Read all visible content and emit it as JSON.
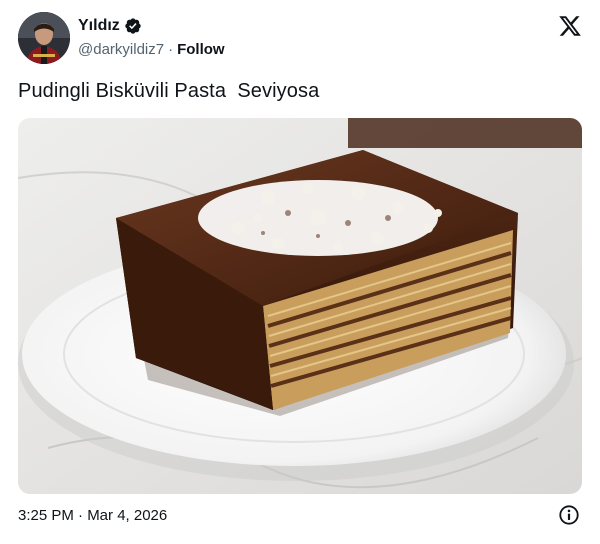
{
  "author": {
    "display_name": "Yıldız",
    "handle": "@darkyildiz7",
    "separator": "·",
    "follow_label": "Follow",
    "verified": true
  },
  "brand_icon": "x-logo-icon",
  "tweet": {
    "text": "Pudingli Bisküvili Pasta  Seviyosa"
  },
  "media": {
    "type": "photo",
    "subject": "chocolate pudding biscuit cake with coconut on white plate"
  },
  "footer": {
    "timestamp": "3:25 PM · Mar 4, 2026",
    "info_icon": "info-icon"
  },
  "colors": {
    "text_primary": "#0f1419",
    "text_secondary": "#536471",
    "verified_badge": "#0f1419",
    "background": "#ffffff"
  }
}
